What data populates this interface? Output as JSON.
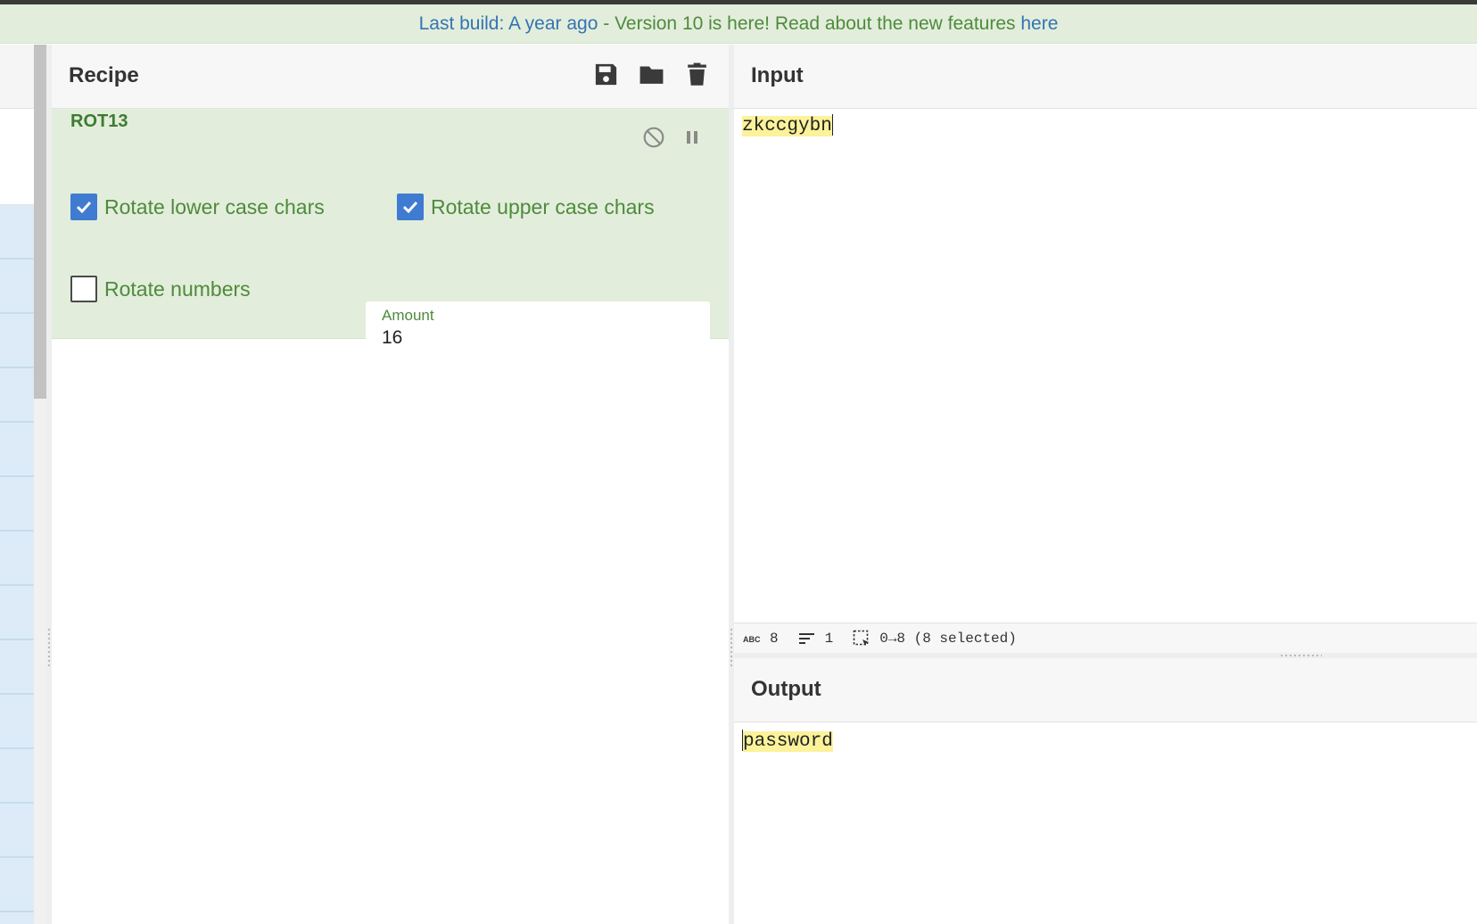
{
  "banner": {
    "part1": "Last build: A year ago",
    "part2": " - Version 10 is here! Read about the new features ",
    "link": "here"
  },
  "recipe": {
    "title": "Recipe",
    "icons": [
      "save-icon",
      "folder-icon",
      "trash-icon"
    ],
    "operation": {
      "name": "ROT13",
      "rotate_lower": {
        "label": "Rotate lower case chars",
        "checked": true
      },
      "rotate_upper": {
        "label": "Rotate upper case chars",
        "checked": true
      },
      "rotate_numbers": {
        "label": "Rotate numbers",
        "checked": false
      },
      "amount": {
        "label": "Amount",
        "value": "16"
      }
    }
  },
  "input": {
    "title": "Input",
    "text": "zkccgybn",
    "stats": {
      "length": "8",
      "lines": "1",
      "selection": "0→8 (8 selected)"
    }
  },
  "output": {
    "title": "Output",
    "text": "password"
  },
  "colors": {
    "accent_green": "#4f8a3d",
    "card_bg": "#e2eedb",
    "checkbox_blue": "#3f7bd1",
    "highlight": "#fbf29a"
  }
}
